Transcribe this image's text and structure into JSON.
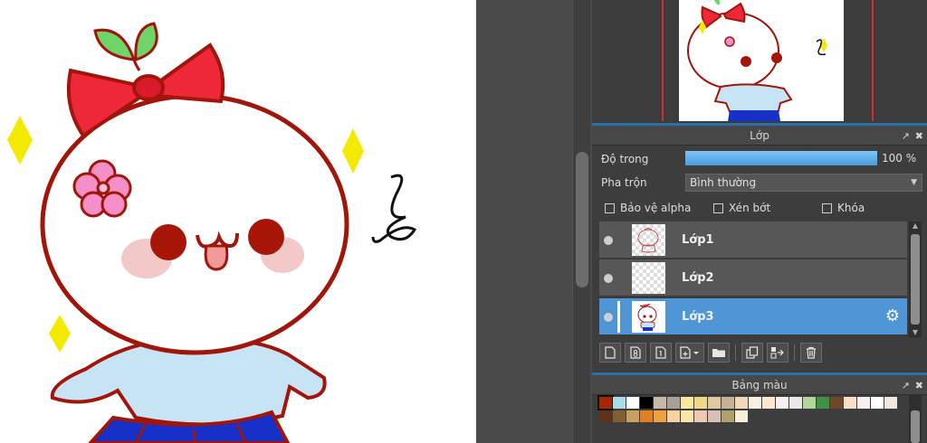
{
  "layers_panel": {
    "title": "Lớp",
    "opacity_label": "Độ trong",
    "opacity_value": "100 %",
    "opacity_percent": 100,
    "blend_label": "Pha trộn",
    "blend_value": "Bình thường",
    "protect_alpha_label": "Bảo vệ alpha",
    "clipping_label": "Xén bớt",
    "lock_label": "Khóa",
    "layers": [
      {
        "name": "Lớp1",
        "active": false
      },
      {
        "name": "Lớp2",
        "active": false
      },
      {
        "name": "Lớp3",
        "active": true
      }
    ]
  },
  "palette_panel": {
    "title": "Bảng màu",
    "row1": [
      "#a32a00",
      "#a7dce8",
      "#ffffff",
      "#000000",
      "#c8b8a8",
      "#a8a098",
      "#f8e8a0",
      "#f0d888",
      "#e0c8a0",
      "#c8b098",
      "#f0d8b8",
      "#f8f0e0",
      "#ffe8d0",
      "#f8f0f0",
      "#e8e8e8",
      "#b0d898",
      "#409048",
      "#704828",
      "#f8e0c8",
      "#f8f0f0",
      "#ffffff",
      "#f0e8e0"
    ],
    "row2": [
      "#603018",
      "#806030",
      "#c8a060",
      "#e08020",
      "#f0a040",
      "#f8d0a0",
      "#f8e8a8",
      "#f0c8b0",
      "#d8c0b8",
      "#b0a070",
      "#f8f0d8"
    ]
  },
  "colors": {
    "accent": "#4f96d6",
    "panel_bg": "#3d3d3d",
    "separator_blue": "#2b6fa8",
    "frame_red": "#d03030"
  },
  "icons": {
    "popout": "popout-icon",
    "close": "close-icon",
    "gear": "gear-icon"
  }
}
